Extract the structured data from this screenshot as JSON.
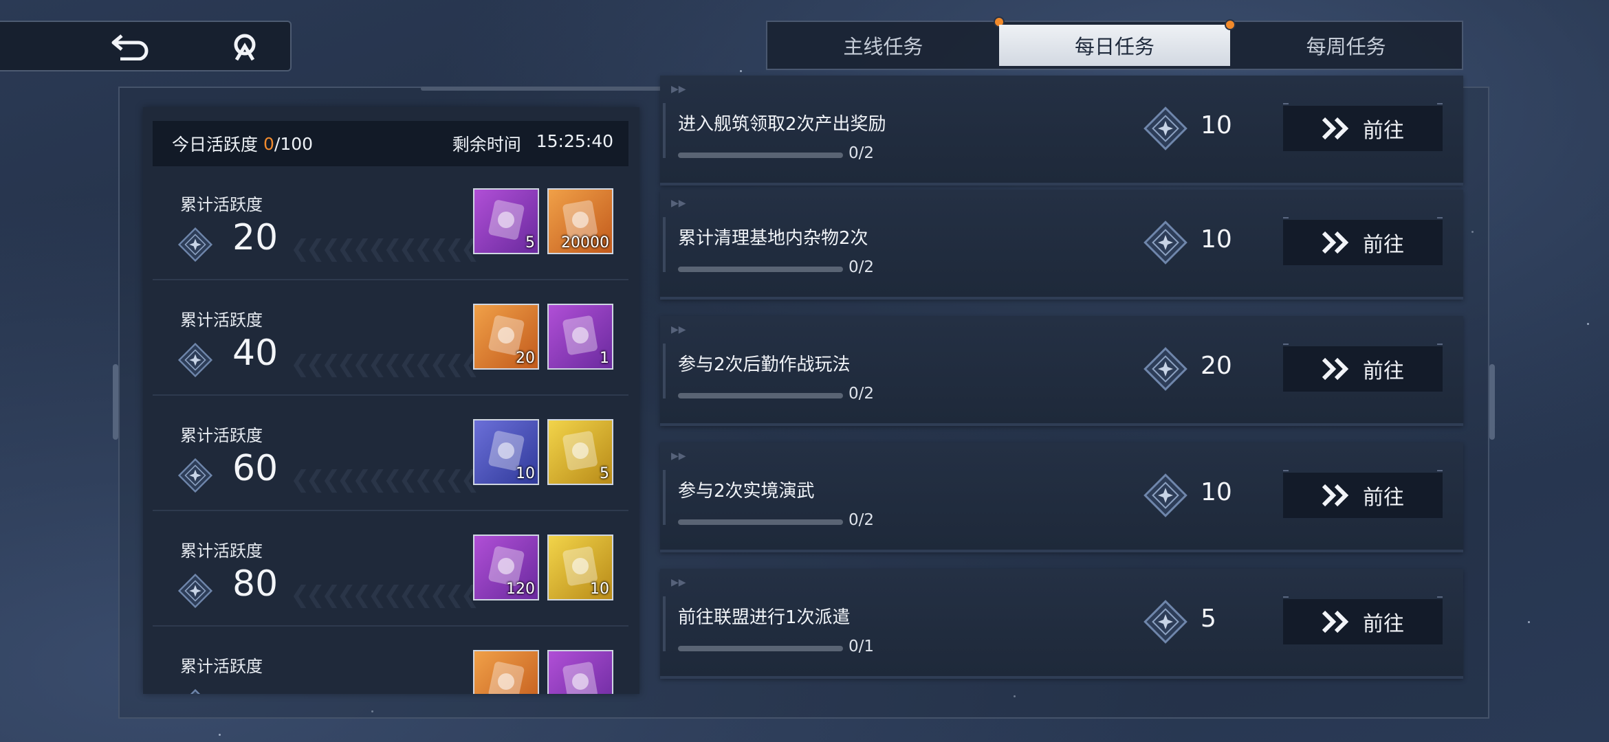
{
  "nav": {
    "back_icon": "back-arrow-icon",
    "home_icon": "home-icon"
  },
  "tabs": [
    {
      "label": "主线任务",
      "active": false,
      "badge": true
    },
    {
      "label": "每日任务",
      "active": true,
      "badge": true
    },
    {
      "label": "每周任务",
      "active": false,
      "badge": false
    }
  ],
  "activity": {
    "label": "今日活跃度",
    "current": "0",
    "total": "/100",
    "remaining_label": "剩余时间",
    "remaining_time": "15:25:40"
  },
  "milestones": [
    {
      "label": "累计活跃度",
      "value": "20",
      "rewards": [
        {
          "icon": "card-ticket-icon",
          "count": "5",
          "color": "purple"
        },
        {
          "icon": "coin-ticket-icon",
          "count": "20000",
          "color": "orange"
        }
      ]
    },
    {
      "label": "累计活跃度",
      "value": "40",
      "rewards": [
        {
          "icon": "star-crystal-icon",
          "count": "20",
          "color": "orange"
        },
        {
          "icon": "mystery-box-icon",
          "count": "1",
          "color": "purple"
        }
      ]
    },
    {
      "label": "累计活跃度",
      "value": "60",
      "rewards": [
        {
          "icon": "crystal-shard-icon",
          "count": "10",
          "color": "blue"
        },
        {
          "icon": "chip-pack-icon",
          "count": "5",
          "color": "yellow"
        }
      ]
    },
    {
      "label": "累计活跃度",
      "value": "80",
      "rewards": [
        {
          "icon": "orbit-sphere-icon",
          "count": "120",
          "color": "purple"
        },
        {
          "icon": "gem-cube-icon",
          "count": "10",
          "color": "yellow"
        }
      ]
    },
    {
      "label": "累计活跃度",
      "value": "",
      "rewards": [
        {
          "icon": "ticket-icon",
          "count": "",
          "color": "orange"
        },
        {
          "icon": "vial-icon",
          "count": "",
          "color": "purple"
        }
      ]
    }
  ],
  "tasks": [
    {
      "title": "进入舰筑领取2次产出奖励",
      "progress": "0/2",
      "fraction": 0,
      "reward": "10",
      "button": "前往"
    },
    {
      "title": "累计清理基地内杂物2次",
      "progress": "0/2",
      "fraction": 0,
      "reward": "10",
      "button": "前往"
    },
    {
      "title": "参与2次后勤作战玩法",
      "progress": "0/2",
      "fraction": 0,
      "reward": "20",
      "button": "前往"
    },
    {
      "title": "参与2次实境演武",
      "progress": "0/2",
      "fraction": 0,
      "reward": "10",
      "button": "前往"
    },
    {
      "title": "前往联盟进行1次派遣",
      "progress": "0/1",
      "fraction": 0,
      "reward": "5",
      "button": "前往"
    }
  ],
  "colors": {
    "accent": "#f08a2e",
    "panel": "#1f293a",
    "tab_active": "#e4e8ee"
  }
}
